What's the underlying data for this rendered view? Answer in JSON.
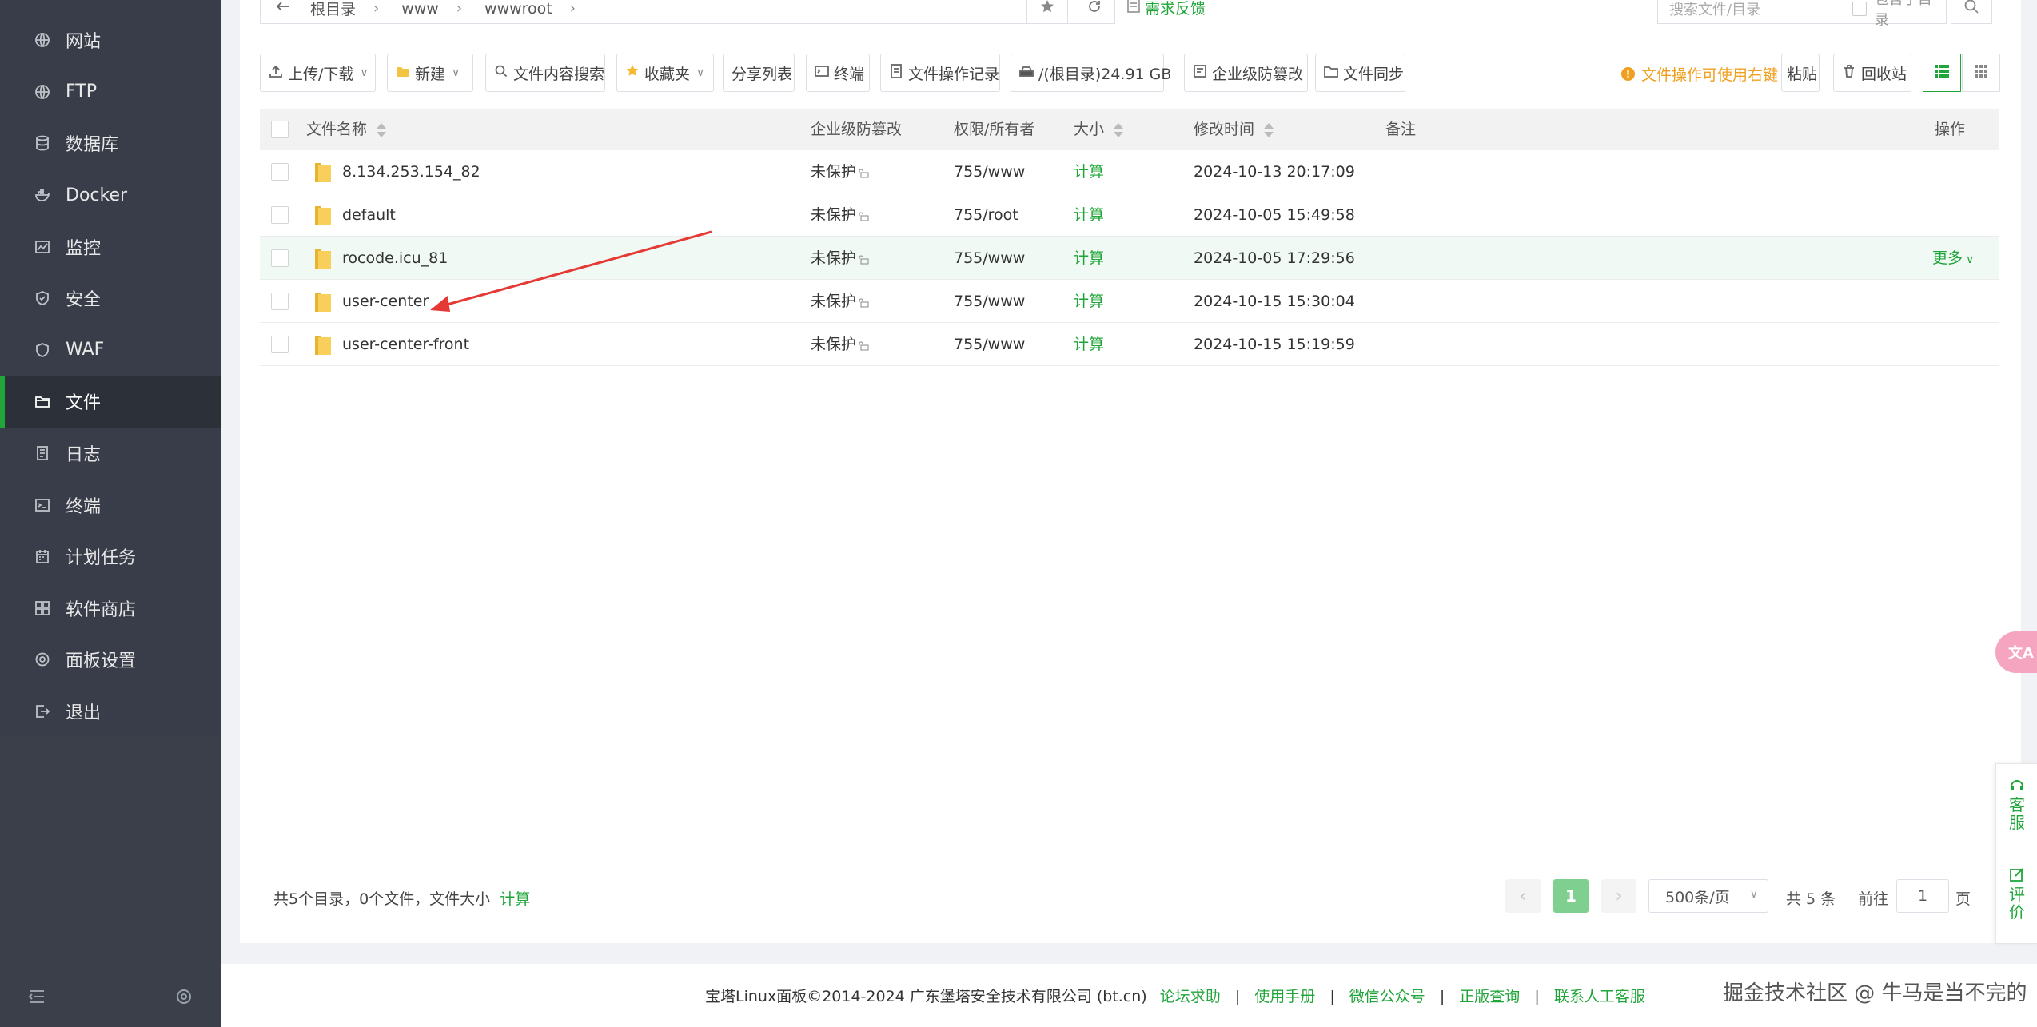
{
  "sidebar": {
    "items": [
      {
        "label": "网站",
        "icon": "globe-icon"
      },
      {
        "label": "FTP",
        "icon": "globe-icon"
      },
      {
        "label": "数据库",
        "icon": "database-icon"
      },
      {
        "label": "Docker",
        "icon": "docker-icon"
      },
      {
        "label": "监控",
        "icon": "monitor-icon"
      },
      {
        "label": "安全",
        "icon": "shield-icon"
      },
      {
        "label": "WAF",
        "icon": "waf-shield-icon"
      },
      {
        "label": "文件",
        "icon": "folder-icon",
        "active": true
      },
      {
        "label": "日志",
        "icon": "log-icon"
      },
      {
        "label": "终端",
        "icon": "terminal-icon"
      },
      {
        "label": "计划任务",
        "icon": "calendar-icon"
      },
      {
        "label": "软件商店",
        "icon": "grid-icon"
      },
      {
        "label": "面板设置",
        "icon": "gear-icon"
      },
      {
        "label": "退出",
        "icon": "logout-icon"
      }
    ]
  },
  "pathbar": {
    "crumbs": [
      "根目录",
      "www",
      "wwwroot"
    ],
    "feedback": "需求反馈",
    "search_placeholder": "搜索文件/目录",
    "include_subdir": "包含子目录"
  },
  "toolbar": {
    "upload": "上传/下载",
    "new": "新建",
    "content_search": "文件内容搜索",
    "favorites": "收藏夹",
    "share_list": "分享列表",
    "terminal": "终端",
    "op_log": "文件操作记录",
    "disk": "/(根目录)24.91 GB",
    "tamper": "企业级防篡改",
    "sync": "文件同步",
    "right_click_tip": "文件操作可使用右键",
    "paste": "粘贴",
    "recycle": "回收站"
  },
  "table": {
    "headers": {
      "name": "文件名称",
      "tamper": "企业级防篡改",
      "perm": "权限/所有者",
      "size": "大小",
      "mtime": "修改时间",
      "remark": "备注",
      "ops": "操作"
    },
    "rows": [
      {
        "name": "8.134.253.154_82",
        "tamper": "未保护",
        "perm": "755/www",
        "size": "计算",
        "mtime": "2024-10-13 20:17:09",
        "more": ""
      },
      {
        "name": "default",
        "tamper": "未保护",
        "perm": "755/root",
        "size": "计算",
        "mtime": "2024-10-05 15:49:58",
        "more": ""
      },
      {
        "name": "rocode.icu_81",
        "tamper": "未保护",
        "perm": "755/www",
        "size": "计算",
        "mtime": "2024-10-05 17:29:56",
        "more": "更多"
      },
      {
        "name": "user-center",
        "tamper": "未保护",
        "perm": "755/www",
        "size": "计算",
        "mtime": "2024-10-15 15:30:04",
        "more": ""
      },
      {
        "name": "user-center-front",
        "tamper": "未保护",
        "perm": "755/www",
        "size": "计算",
        "mtime": "2024-10-15 15:19:59",
        "more": ""
      }
    ]
  },
  "summary": {
    "text": "共5个目录，0个文件，文件大小",
    "calc": "计算"
  },
  "pagination": {
    "current": "1",
    "per_page": "500条/页",
    "total": "共 5 条",
    "goto_label": "前往",
    "goto_value": "1",
    "page_unit": "页"
  },
  "footer": {
    "copyright": "宝塔Linux面板©2014-2024 广东堡塔安全技术有限公司 (bt.cn)",
    "links": [
      "论坛求助",
      "使用手册",
      "微信公众号",
      "正版查询",
      "联系人工客服"
    ],
    "watermark": "掘金技术社区 @ 牛马是当不完的"
  },
  "float": {
    "service": "客服",
    "review": "评价"
  },
  "colors": {
    "accent": "#20a53a",
    "sidebar_bg": "#393d49",
    "warning": "#f0a020"
  }
}
